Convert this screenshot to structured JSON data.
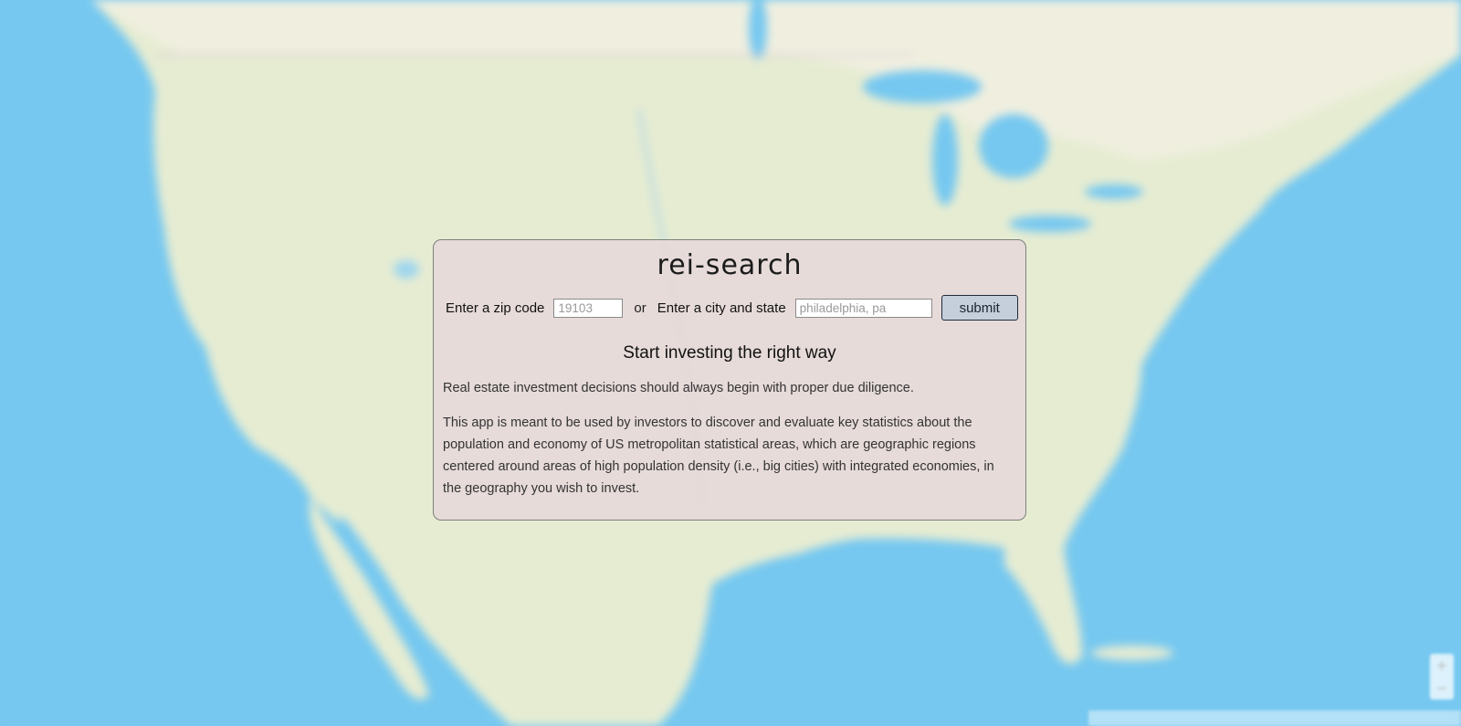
{
  "app": {
    "brand": "rei-search"
  },
  "search": {
    "zip_label": "Enter a zip code",
    "zip_placeholder": "19103",
    "zip_value": "",
    "or_label": "or",
    "city_label": "Enter a city and state",
    "city_placeholder": "philadelphia, pa",
    "city_value": "",
    "submit_label": "submit"
  },
  "intro": {
    "headline": "Start investing the right way",
    "paragraph_1": "Real estate investment decisions should always begin with proper due diligence.",
    "paragraph_2": "This app is meant to be used by investors to discover and evaluate key statistics about the population and economy of US metropolitan statistical areas, which are geographic regions centered around areas of high population density (i.e., big cities) with integrated economies, in the geography you wish to invest."
  },
  "map": {
    "zoom_in_icon": "plus-icon",
    "zoom_out_icon": "minus-icon",
    "colors": {
      "water": "#76c8f0",
      "land": "#e6ecd2",
      "land_alt": "#f0efdf",
      "panel_bg": "#e6dad8",
      "submit_bg": "#c5cfdb"
    }
  }
}
